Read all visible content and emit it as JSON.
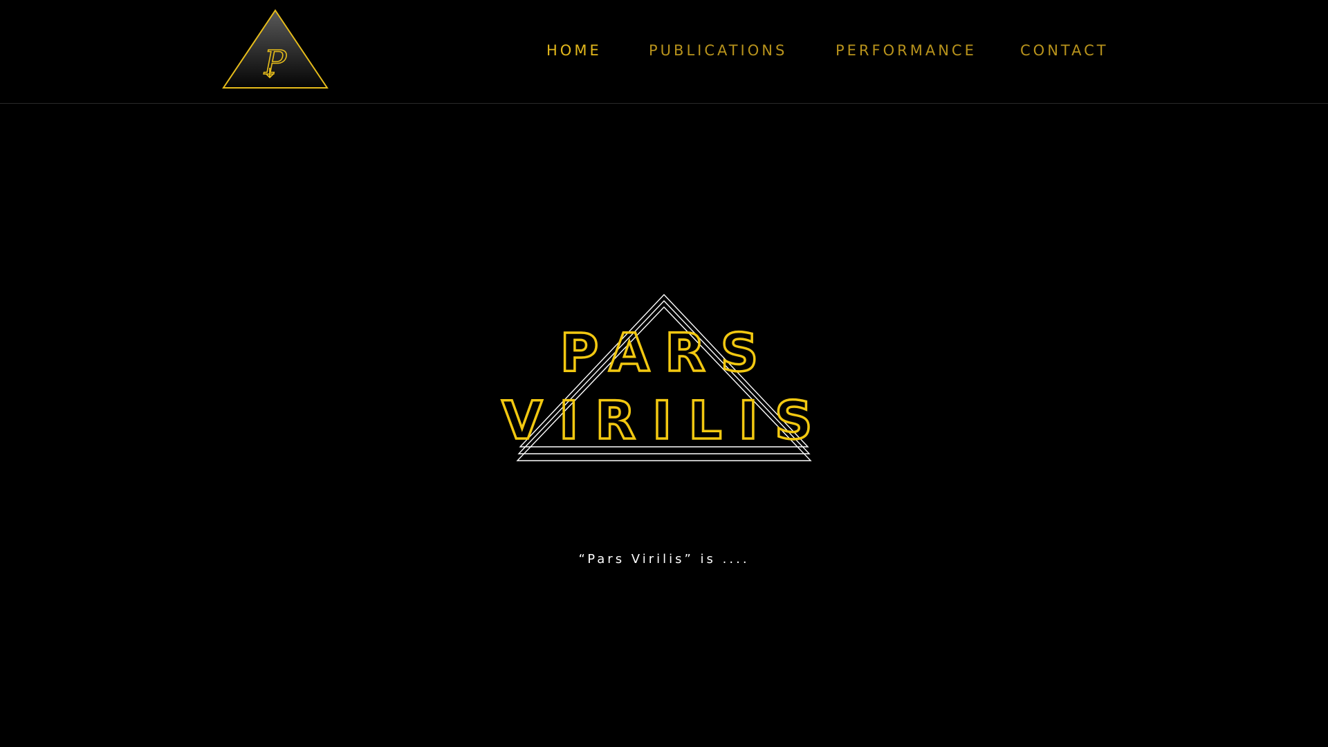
{
  "nav": {
    "items": [
      {
        "label": "HOME",
        "active": true
      },
      {
        "label": "PUBLICATIONS",
        "active": false
      },
      {
        "label": "PERFORMANCE",
        "active": false
      },
      {
        "label": "CONTACT",
        "active": false
      }
    ]
  },
  "logo": {
    "icon": "pyramid-p-logo-icon",
    "letter": "P"
  },
  "hero": {
    "title_line1": "PARS",
    "title_line2": "VIRILIS",
    "tagline": "“Pars Virilis” is ...."
  },
  "colors": {
    "background": "#000000",
    "accent": "#f2c811",
    "nav_inactive": "#b8931c",
    "nav_active": "#e3b81c",
    "outline_white": "#ffffff"
  }
}
